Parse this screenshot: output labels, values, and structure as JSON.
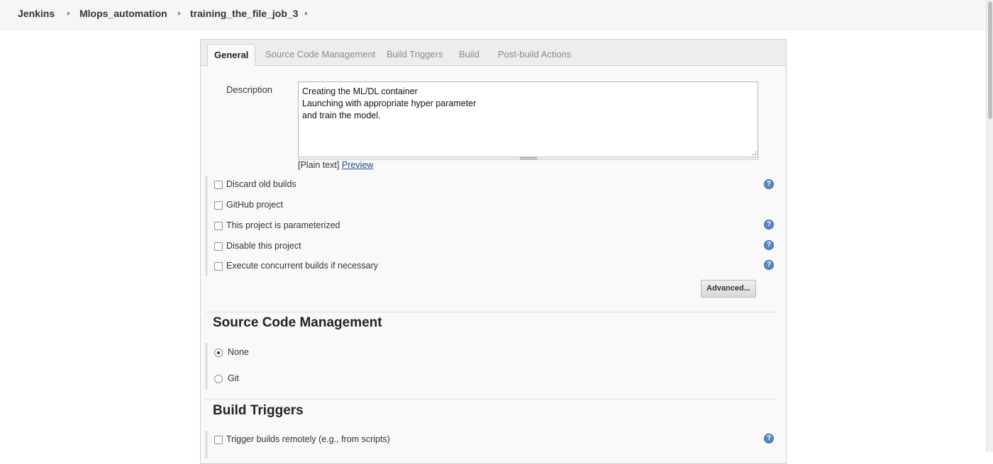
{
  "breadcrumbs": [
    "Jenkins",
    "Mlops_automation",
    "training_the_file_job_3"
  ],
  "tabs": [
    "General",
    "Source Code Management",
    "Build Triggers",
    "Build",
    "Post-build Actions"
  ],
  "general": {
    "description_label": "Description",
    "description_lines": [
      "Creating the ML/DL container",
      "Launching with appropriate hyper parameter",
      "and train the model."
    ],
    "plain_text": "[Plain text]",
    "preview_link": "Preview",
    "options": [
      {
        "label": "Discard old builds",
        "checked": false,
        "help": true
      },
      {
        "label": "GitHub project",
        "checked": false,
        "help": false
      },
      {
        "label": "This project is parameterized",
        "checked": false,
        "help": true
      },
      {
        "label": "Disable this project",
        "checked": false,
        "help": true
      },
      {
        "label": "Execute concurrent builds if necessary",
        "checked": false,
        "help": true
      }
    ],
    "advanced_button": "Advanced..."
  },
  "scm": {
    "title": "Source Code Management",
    "options": [
      {
        "label": "None",
        "selected": true
      },
      {
        "label": "Git",
        "selected": false
      }
    ]
  },
  "build_triggers": {
    "title": "Build Triggers",
    "options": [
      {
        "label": "Trigger builds remotely (e.g., from scripts)",
        "checked": false,
        "help": true
      }
    ]
  },
  "icons": {
    "help": "help-icon",
    "breadcrumb_separator": "chevron-right-icon"
  },
  "colors": {
    "help_icon": "#5b87c5",
    "link": "#204a87",
    "tabbar": "#ededed"
  }
}
